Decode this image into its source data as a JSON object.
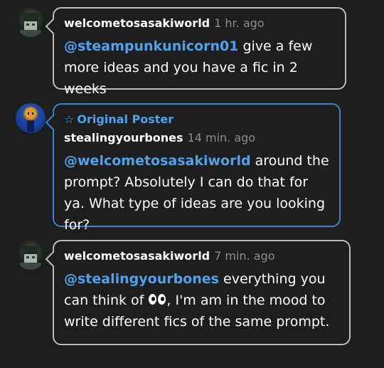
{
  "comments": [
    {
      "username": "welcometosasakiworld",
      "time": "1 hr. ago",
      "mention": "@steampunkunicorn01",
      "body": " give a few more ideas and you have a fic in 2 weeks"
    },
    {
      "badge": "Original Poster",
      "username": "stealingyourbones",
      "time": "14 min. ago",
      "mention": "@welcometosasakiworld",
      "body": " around the prompt? Absolutely I can do that for ya. What type of ideas are you looking for?"
    },
    {
      "username": "welcometosasakiworld",
      "time": "7 min. ago",
      "mention": "@stealingyourbones",
      "body_before": " everything you can think of ",
      "emoji": "eyes-emoji",
      "body_after": ", I'm am in the mood to write different fics of the same prompt."
    }
  ],
  "icons": {
    "op_badge": "star-outline-icon"
  },
  "colors": {
    "background": "#1e1e1e",
    "mention": "#4fa3ec",
    "op_border": "#2f86d6",
    "bubble_border": "#bdbdbd",
    "timestamp": "#8d8d8d"
  }
}
